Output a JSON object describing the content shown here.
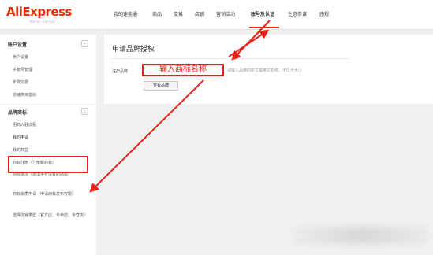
{
  "logo": {
    "main": "AliExpress",
    "sub": "Seller Center"
  },
  "nav": [
    {
      "label": "我的速卖通"
    },
    {
      "label": "商品"
    },
    {
      "label": "交易"
    },
    {
      "label": "店铺"
    },
    {
      "label": "营销活动"
    },
    {
      "label": "账号及认证",
      "active": true
    },
    {
      "label": "生意参谋"
    },
    {
      "label": "违规"
    }
  ],
  "sidebar": {
    "account_settings": {
      "title": "账户设置",
      "toggle": "-",
      "items": [
        "账户设置",
        "子账号管理",
        "年费交费",
        "店铺类目指标"
      ]
    },
    "brand_trademark": {
      "title": "品牌商标",
      "toggle": "-",
      "items": [
        "招商入驻流程",
        "我的申请",
        "我的权益",
        "商标注册（注册新商标）",
        "商标添加（添加平台没有的商标）",
        "商标资质申请（申请商标发布权限）",
        "选择店铺类型（官方店、专卖店、专营店）"
      ]
    }
  },
  "panel": {
    "title": "申请品牌授权",
    "form_label": "注册品牌",
    "input_value": "输入商标名称",
    "input_hint": "请输入品牌的中文或英文名称，不区分大小",
    "search_button": "查看品牌"
  },
  "colors": {
    "accent": "#e62e04",
    "annotation": "#e8221a"
  }
}
